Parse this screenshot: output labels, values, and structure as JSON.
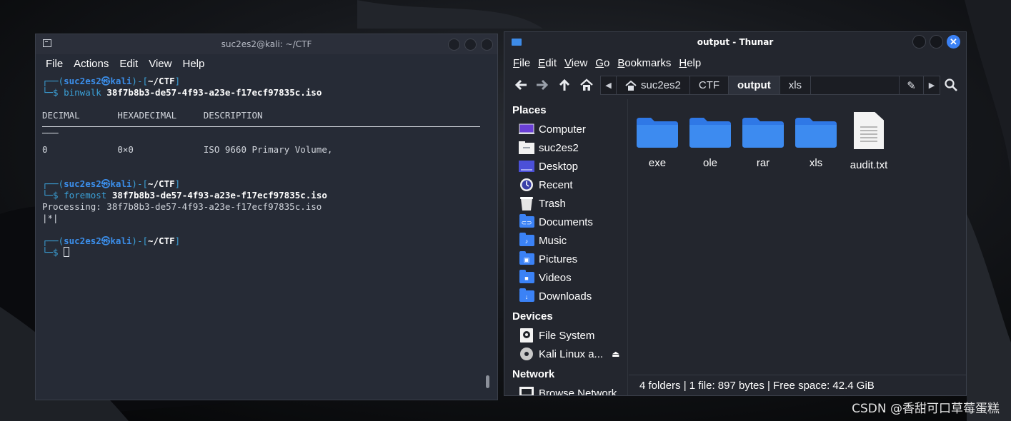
{
  "terminal": {
    "title": "suc2es2@kali: ~/CTF",
    "menu": [
      "File",
      "Actions",
      "Edit",
      "View",
      "Help"
    ],
    "prompt": {
      "frame_open": "┌──(",
      "user": "suc2es2",
      "at": "㉿",
      "host": "kali",
      "mid": ")-[",
      "dir": "~/CTF",
      "close": "]",
      "frame_cmd": "└─$ "
    },
    "cmd1": {
      "name": "binwalk",
      "arg": "38f7b8b3-de57-4f93-a23e-f17ecf97835c.iso"
    },
    "table_header": "DECIMAL       HEXADECIMAL     DESCRIPTION",
    "table_dash": "───",
    "table_row": "0             0×0             ISO 9660 Primary Volume,",
    "cmd2": {
      "name": "foremost",
      "arg": "38f7b8b3-de57-4f93-a23e-f17ecf97835c.iso"
    },
    "processing": "Processing: 38f7b8b3-de57-4f93-a23e-f17ecf97835c.iso",
    "progress": "|*|"
  },
  "thunar": {
    "title": "output - Thunar",
    "close_glyph": "✕",
    "menu": [
      {
        "first": "F",
        "rest": "ile"
      },
      {
        "first": "E",
        "rest": "dit"
      },
      {
        "first": "V",
        "rest": "iew"
      },
      {
        "first": "G",
        "rest": "o"
      },
      {
        "first": "B",
        "rest": "ookmarks"
      },
      {
        "first": "H",
        "rest": "elp"
      }
    ],
    "path": [
      "suc2es2",
      "CTF",
      "output",
      "xls"
    ],
    "sidebar": {
      "places_label": "Places",
      "places": [
        "Computer",
        "suc2es2",
        "Desktop",
        "Recent",
        "Trash",
        "Documents",
        "Music",
        "Pictures",
        "Videos",
        "Downloads"
      ],
      "devices_label": "Devices",
      "devices": [
        "File System",
        "Kali Linux a..."
      ],
      "network_label": "Network",
      "network": [
        "Browse Network"
      ]
    },
    "files": [
      {
        "name": "exe",
        "type": "folder"
      },
      {
        "name": "ole",
        "type": "folder"
      },
      {
        "name": "rar",
        "type": "folder"
      },
      {
        "name": "xls",
        "type": "folder"
      },
      {
        "name": "audit.txt",
        "type": "text-file"
      }
    ],
    "status": "4 folders  |  1 file: 897 bytes  |  Free space: 42.4 GiB"
  },
  "watermark": "CSDN @香甜可口草莓蛋糕",
  "colors": {
    "accent": "#3b82f6",
    "prompt_user": "#3b8eea",
    "prompt_frame": "#3ba1d8",
    "terminal_bg": "#262b36",
    "thunar_bg": "#23262e"
  }
}
